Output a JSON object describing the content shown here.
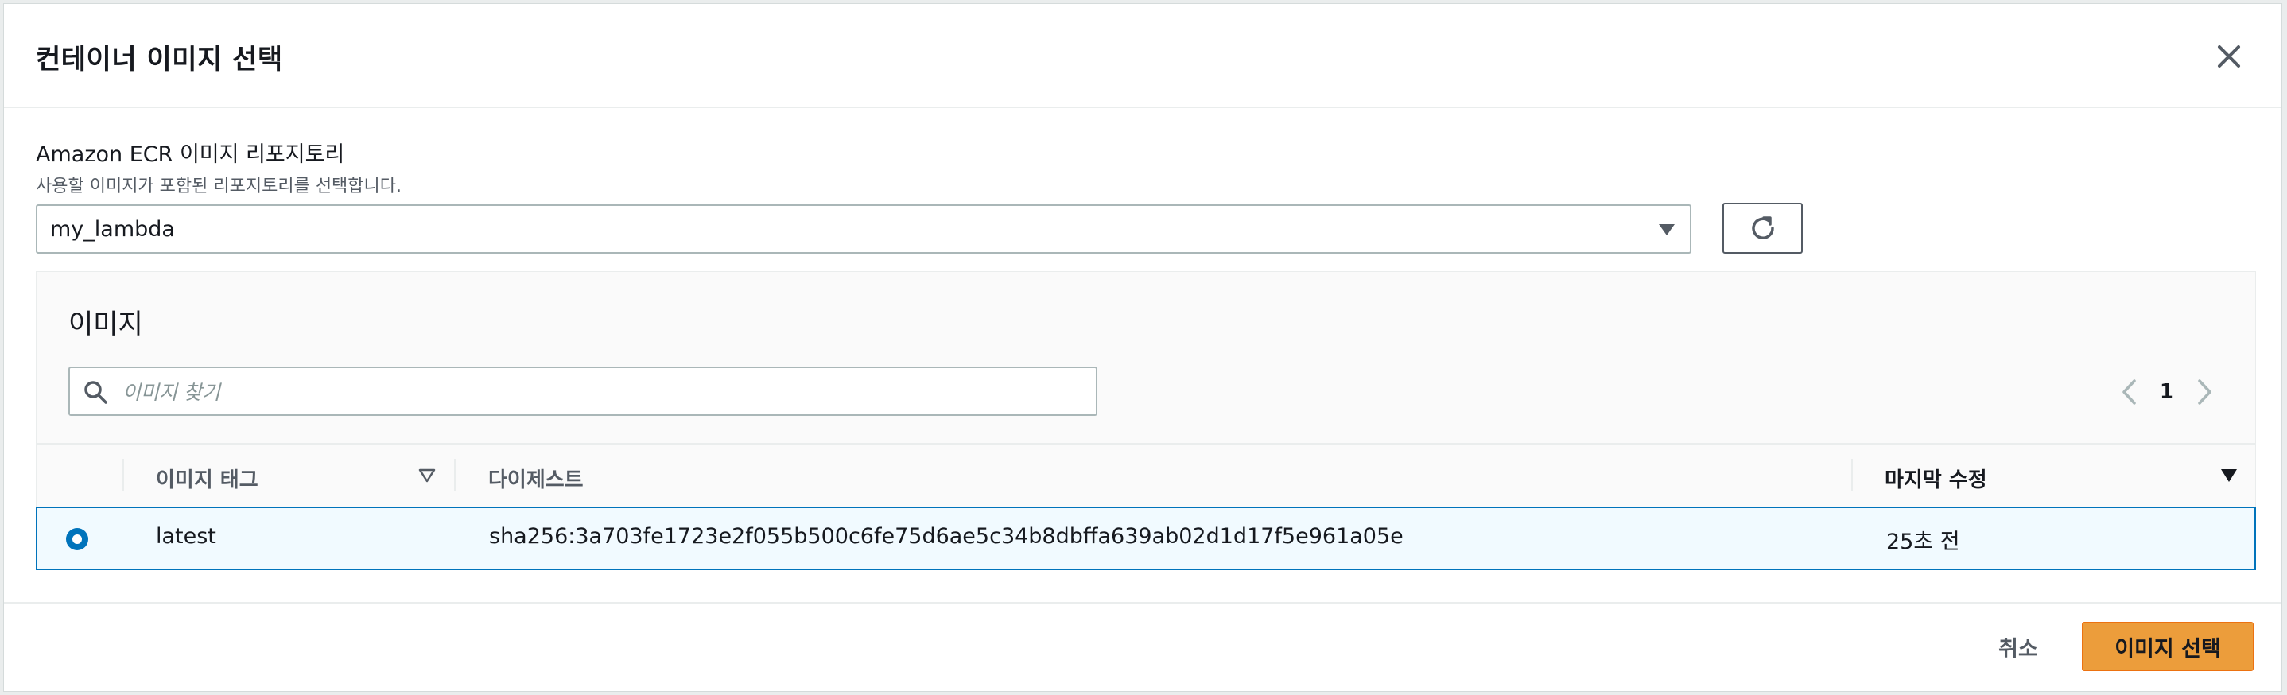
{
  "modal": {
    "title": "컨테이너 이미지 선택"
  },
  "repository": {
    "label": "Amazon ECR 이미지 리포지토리",
    "description": "사용할 이미지가 포함된 리포지토리를 선택합니다.",
    "selected": "my_lambda"
  },
  "images": {
    "title": "이미지",
    "search_placeholder": "이미지 찾기",
    "current_page": "1",
    "columns": {
      "tag": "이미지 태그",
      "digest": "다이제스트",
      "last_modified": "마지막 수정"
    },
    "rows": [
      {
        "tag": "latest",
        "digest": "sha256:3a703fe1723e2f055b500c6fe75d6ae5c34b8dbffa639ab02d1d17f5e961a05e",
        "last_modified": "25초 전"
      }
    ]
  },
  "footer": {
    "cancel_label": "취소",
    "confirm_label": "이미지 선택"
  },
  "colors": {
    "accent": "#0073bb",
    "primary_button": "#ec9d3b",
    "selected_row_bg": "#f1faff"
  },
  "icons": [
    "close-icon",
    "caret-down-icon",
    "refresh-icon",
    "search-icon",
    "chevron-left-icon",
    "chevron-right-icon",
    "sort-icon",
    "sort-desc-icon"
  ]
}
